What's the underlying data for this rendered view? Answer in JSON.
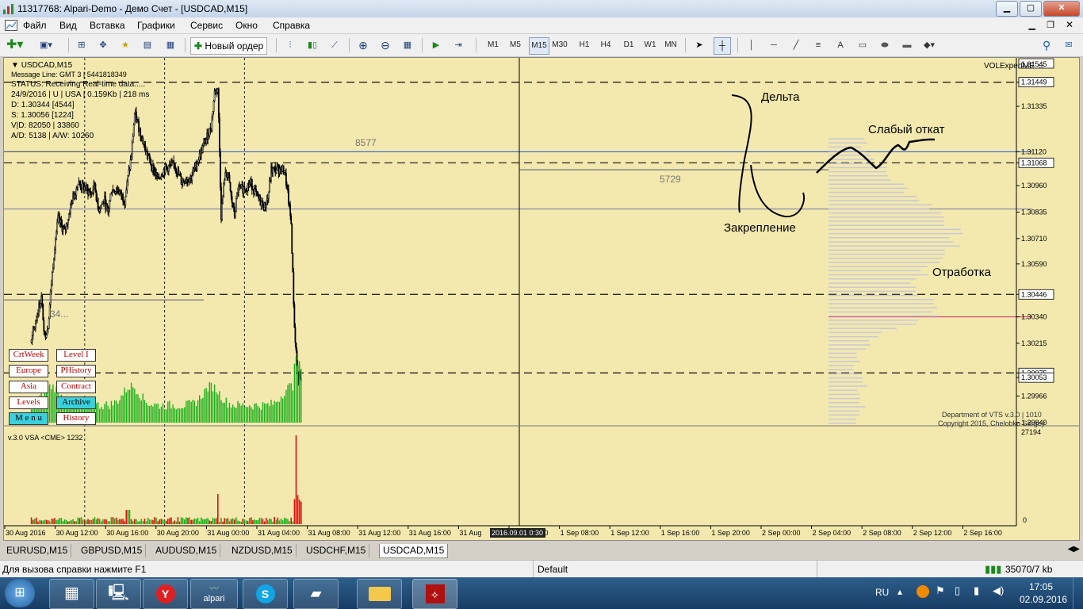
{
  "window": {
    "title": "11317768: Alpari-Demo - Демо Счет - [USDCAD,M15]",
    "min": "▁",
    "max": "▢",
    "close": "✕"
  },
  "menu": [
    "Файл",
    "Вид",
    "Вставка",
    "Графики",
    "Сервис",
    "Окно",
    "Справка"
  ],
  "toolbar": {
    "new_order": "Новый ордер",
    "timeframes": [
      "M1",
      "M5",
      "M15",
      "M30",
      "H1",
      "H4",
      "D1",
      "W1",
      "MN"
    ],
    "active_timeframe": "M15",
    "text_tool": "A"
  },
  "chart_info": {
    "symbol": "USDCAD,M15",
    "message_line": "Message Line: GMT 3 | 5441818349",
    "status": "STATUS:  Receiving Real-time data.....",
    "session": "24/9/2016 | U | USA | 0.159Kb | 218 ms",
    "d": "D: 1.30344  [4544]",
    "s": "S: 1.30056  [1224]",
    "vd": "V|D: 82050 | 33860",
    "ad": "A/D: 5138 | A/W: 10260",
    "expert": "VOLExpertME ☺",
    "credit1": "Department of VTS v.3.0 | 1010",
    "credit2": "Copyright 2015, Chelobko Sergey"
  },
  "chart_data": {
    "type": "candlestick",
    "symbol": "USDCAD",
    "timeframe": "M15",
    "price_ticks": [
      "1.31449",
      "1.31335",
      "1.31120",
      "1.31068",
      "1.30960",
      "1.30835",
      "1.30710",
      "1.30590",
      "1.30446",
      "1.30340",
      "1.30215",
      "1.30075",
      "1.30053",
      "1.29966",
      "1.29840"
    ],
    "highlighted_prices": [
      "1.31545",
      "1.31449",
      "1.31068",
      "1.30446",
      "1.30075",
      "1.30053"
    ],
    "price_range": [
      1.2984,
      1.31545
    ],
    "time_labels": [
      "30 Aug 2016",
      "30 Aug 12:00",
      "30 Aug 16:00",
      "30 Aug 20:00",
      "31 Aug 00:00",
      "31 Aug 04:00",
      "31 Aug 08:00",
      "31 Aug 12:00",
      "31 Aug 16:00",
      "31 Aug",
      "1 Sep 04:00",
      "1 Sep 08:00",
      "1 Sep 12:00",
      "1 Sep 16:00",
      "1 Sep 20:00",
      "2 Sep 00:00",
      "2 Sep 04:00",
      "2 Sep 08:00",
      "2 Sep 12:00",
      "2 Sep 16:00"
    ],
    "crosshair_time": "2016.09.01 0:30",
    "level_labels": [
      "8577",
      "5729",
      "34..."
    ],
    "annotations": [
      "Дельта",
      "Слабый откат",
      "Закрепление",
      "Отработка"
    ],
    "close_path": [
      [
        "30 Aug 08:00",
        1.3022
      ],
      [
        "30 Aug 10:00",
        1.3037
      ],
      [
        "30 Aug 11:00",
        1.3043
      ],
      [
        "30 Aug 12:00",
        1.3025
      ],
      [
        "30 Aug 13:00",
        1.303
      ],
      [
        "30 Aug 14:00",
        1.305
      ],
      [
        "30 Aug 15:00",
        1.3068
      ],
      [
        "30 Aug 16:00",
        1.308
      ],
      [
        "30 Aug 18:00",
        1.3074
      ],
      [
        "30 Aug 20:00",
        1.3088
      ],
      [
        "30 Aug 22:00",
        1.3097
      ],
      [
        "31 Aug 00:00",
        1.3095
      ],
      [
        "31 Aug 02:00",
        1.3092
      ],
      [
        "31 Aug 03:00",
        1.3097
      ],
      [
        "31 Aug 04:00",
        1.3085
      ],
      [
        "31 Aug 06:00",
        1.3089
      ],
      [
        "31 Aug 07:00",
        1.3083
      ],
      [
        "31 Aug 08:00",
        1.3094
      ],
      [
        "31 Aug 10:00",
        1.3094
      ],
      [
        "31 Aug 12:00",
        1.3089
      ],
      [
        "31 Aug 14:00",
        1.311
      ],
      [
        "31 Aug 15:00",
        1.313
      ],
      [
        "31 Aug 16:00",
        1.3125
      ],
      [
        "31 Aug 18:00",
        1.3114
      ],
      [
        "31 Aug 20:00",
        1.3106
      ],
      [
        "31 Aug 22:00",
        1.3099
      ],
      [
        "1 Sep 00:00",
        1.3104
      ],
      [
        "1 Sep 03:00",
        1.3106
      ],
      [
        "1 Sep 05:00",
        1.3098
      ],
      [
        "1 Sep 08:00",
        1.31
      ],
      [
        "1 Sep 10:00",
        1.3108
      ],
      [
        "1 Sep 12:00",
        1.3116
      ],
      [
        "1 Sep 14:00",
        1.3124
      ],
      [
        "1 Sep 15:00",
        1.314
      ],
      [
        "1 Sep 16:00",
        1.3142
      ],
      [
        "1 Sep 17:00",
        1.3082
      ],
      [
        "1 Sep 18:00",
        1.31
      ],
      [
        "1 Sep 19:00",
        1.3102
      ],
      [
        "1 Sep 20:00",
        1.309
      ],
      [
        "1 Sep 21:00",
        1.3082
      ],
      [
        "1 Sep 22:00",
        1.3094
      ],
      [
        "2 Sep 00:00",
        1.3095
      ],
      [
        "2 Sep 02:00",
        1.3097
      ],
      [
        "2 Sep 04:00",
        1.309
      ],
      [
        "2 Sep 06:00",
        1.3086
      ],
      [
        "2 Sep 07:00",
        1.309
      ],
      [
        "2 Sep 08:00",
        1.3103
      ],
      [
        "2 Sep 10:00",
        1.3104
      ],
      [
        "2 Sep 12:00",
        1.3103
      ],
      [
        "2 Sep 13:00",
        1.3092
      ],
      [
        "2 Sep 14:00",
        1.3078
      ],
      [
        "2 Sep 15:00",
        1.3029
      ],
      [
        "2 Sep 16:00",
        1.3006
      ],
      [
        "2 Sep 17:00",
        1.3003
      ]
    ],
    "volume_indicator": {
      "title": "v.3.0 VSA <CME> 1232",
      "max": "27194",
      "min": "0"
    }
  },
  "chart_buttons": [
    {
      "label": "CrtWeek",
      "style": "white"
    },
    {
      "label": "Level I",
      "style": "white"
    },
    {
      "label": "Europe",
      "style": "white"
    },
    {
      "label": "PHistory",
      "style": "white"
    },
    {
      "label": "Asia",
      "style": "white"
    },
    {
      "label": "Contract",
      "style": "white"
    },
    {
      "label": "Levels",
      "style": "white"
    },
    {
      "label": "Archive",
      "style": "cyan"
    },
    {
      "label": "M e n u",
      "style": "cyan"
    },
    {
      "label": "History",
      "style": "white"
    }
  ],
  "tabs": [
    "EURUSD,M15",
    "GBPUSD,M15",
    "AUDUSD,M15",
    "NZDUSD,M15",
    "USDCHF,M15",
    "USDCAD,M15"
  ],
  "active_tab": "USDCAD,M15",
  "status": {
    "help": "Для вызова справки нажмите F1",
    "profile": "Default",
    "traffic": "35070/7 kb"
  },
  "taskbar": {
    "lang": "RU",
    "time": "17:05",
    "date": "02.09.2016",
    "alpari_label": "alpari"
  },
  "colors": {
    "chart_bg": "#f3e9ae",
    "blue_level": "#1f4fd0",
    "vol_green": "#1bb01b",
    "vol_red": "#e01010",
    "profile": "#c8c8d8"
  }
}
